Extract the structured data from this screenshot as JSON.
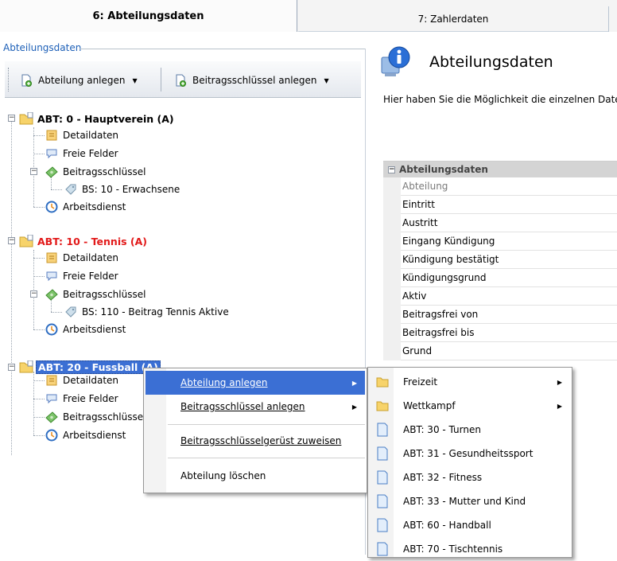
{
  "tabs": [
    {
      "label": "6: Abteilungsdaten"
    },
    {
      "label": "7: Zahlerdaten"
    }
  ],
  "group_label": "Abteilungsdaten",
  "toolbar": {
    "btn_abteilung": "Abteilung anlegen",
    "btn_beitrag": "Beitragsschlüssel anlegen"
  },
  "tree": {
    "abt0": {
      "label": "ABT: 0 - Hauptverein (A)",
      "detail": "Detaildaten",
      "freie": "Freie Felder",
      "beitrag": "Beitragsschlüssel",
      "bs": "BS: 10 - Erwachsene",
      "arbeit": "Arbeitsdienst"
    },
    "abt10": {
      "label": "ABT: 10 - Tennis (A)",
      "detail": "Detaildaten",
      "freie": "Freie Felder",
      "beitrag": "Beitragsschlüssel",
      "bs": "BS: 110 - Beitrag Tennis Aktive",
      "arbeit": "Arbeitsdienst"
    },
    "abt20": {
      "label": "ABT: 20 - Fussball (A)",
      "detail": "Detaildaten",
      "freie": "Freie Felder",
      "beitrag": "Beitragsschlüssel",
      "arbeit": "Arbeitsdienst"
    }
  },
  "right_panel": {
    "title": "Abteilungsdaten",
    "description": "Hier haben Sie die Möglichkeit die einzelnen Daten der Abteilung zu bearbeiten.",
    "grid_header": "Abteilungsdaten",
    "fields": [
      "Abteilung",
      "Eintritt",
      "Austritt",
      "Eingang Kündigung",
      "Kündigung bestätigt",
      "Kündigungsgrund",
      "Aktiv",
      "Beitragsfrei von",
      "Beitragsfrei bis",
      "Grund"
    ]
  },
  "context_menu": {
    "items": [
      {
        "label": "Abteilung anlegen"
      },
      {
        "label": "Beitragsschlüssel anlegen"
      },
      {
        "label": "Beitragsschlüsselgerüst zuweisen"
      },
      {
        "label": "Abteilung löschen"
      }
    ]
  },
  "submenu": {
    "items": [
      {
        "label": "Freizeit"
      },
      {
        "label": "Wettkampf"
      },
      {
        "label": "ABT: 30 - Turnen"
      },
      {
        "label": "ABT: 31 - Gesundheitssport"
      },
      {
        "label": "ABT: 32 - Fitness"
      },
      {
        "label": "ABT: 33 - Mutter und Kind"
      },
      {
        "label": "ABT: 60 - Handball"
      },
      {
        "label": "ABT: 70 - Tischtennis"
      }
    ]
  },
  "colors": {
    "selection": "#3b6fd4",
    "red_label": "#e21a1a",
    "group_label": "#1c5fb7"
  }
}
